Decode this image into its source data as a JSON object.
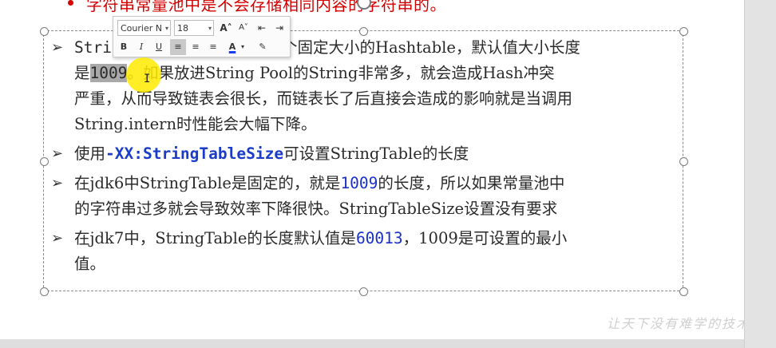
{
  "top_line": "字符串常量池中是不会存储相同内容的字符串的。",
  "toolbar": {
    "font_name": "Courier N",
    "font_size": "18",
    "grow_font": "A˄",
    "shrink_font": "A˅",
    "bold": "B",
    "italic": "I",
    "underline": "U",
    "font_color": "A"
  },
  "bullets": {
    "b1_line1_start": "Stri",
    "b1_line1_end": "是一个固定大小的Hashtable，默认值大小长度",
    "b1_line2_prefix": "是",
    "b1_highlight": "1009",
    "b1_line2_rest": "。如果放进String Pool的String非常多，就会造成Hash冲突",
    "b1_line3": "严重，从而导致链表会很长，而链表长了后直接会造成的影响就是当调用",
    "b1_line4": "String.intern时性能会大幅下降。",
    "b2_prefix": "使用",
    "b2_param": "-XX:StringTableSize",
    "b2_suffix": "可设置StringTable的长度",
    "b3_prefix": "在jdk6中StringTable是固定的，就是",
    "b3_value": "1009",
    "b3_rest1": "的长度，所以如果常量池中",
    "b3_line2": "的字符串过多就会导致效率下降很快。StringTableSize设置没有要求",
    "b4_prefix": "在jdk7中，StringTable的长度默认值是",
    "b4_value": "60013",
    "b4_rest1": "，1009是可设置的最小",
    "b4_line2": "值。"
  },
  "watermark": "让天下没有难学的技术",
  "colors": {
    "red_text": "#d40000",
    "blue_text": "#1a30c8",
    "highlight": "#a9a9a9",
    "cursor": "#ffeb00"
  }
}
